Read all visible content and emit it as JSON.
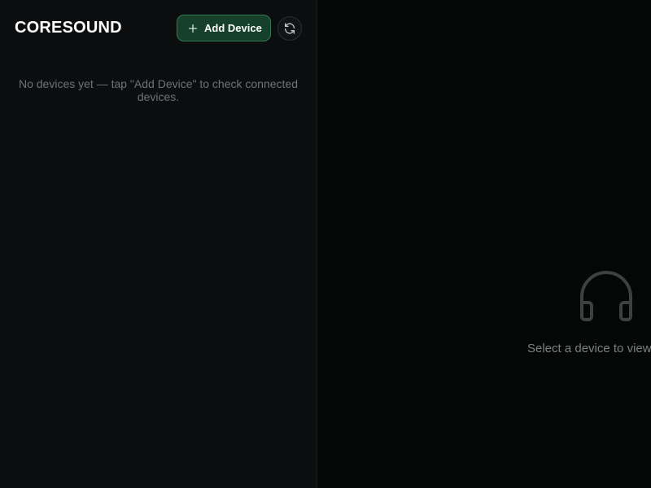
{
  "app": {
    "brand": "CORESOUND"
  },
  "sidebar": {
    "add_device_label": "Add Device",
    "empty_message": "No devices yet — tap \"Add Device\" to check connected devices."
  },
  "main": {
    "placeholder_text": "Select a device to view s"
  },
  "icons": {
    "add": "plus-icon",
    "refresh": "refresh-icon",
    "placeholder": "headphones-icon"
  },
  "colors": {
    "accent": "#16402a",
    "accent_border": "#2f7a4e",
    "background": "#050606",
    "sidebar": "#0c0d0e"
  }
}
